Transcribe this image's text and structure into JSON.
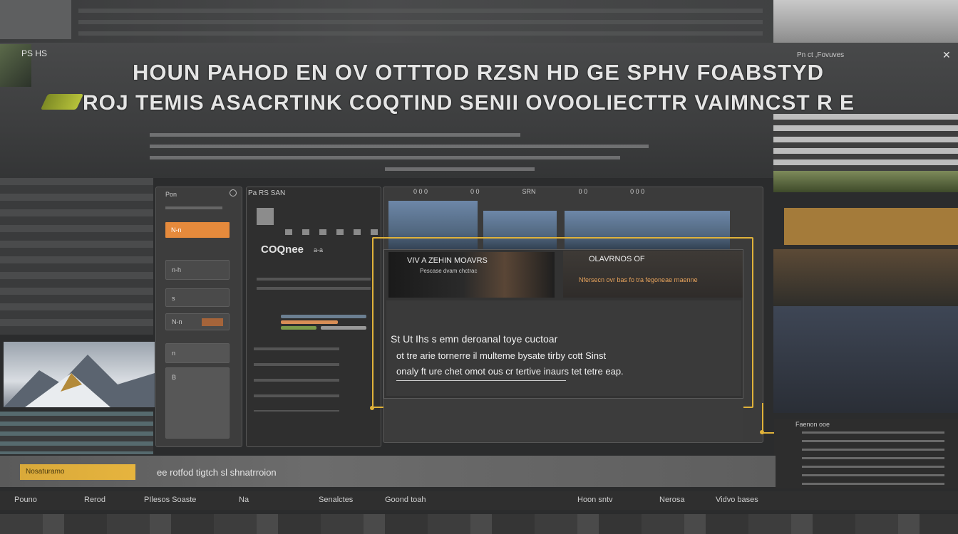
{
  "header": {
    "top_left_label": "PS HS",
    "top_right_label": "Pn ct ,Fovuves",
    "title_line1": "HOUN PAHOD EN OV OTTTOD RZSN HD GE SPHV FOABSTYD",
    "title_line2": "ROJ TEMIS ASACRTINK COQTIND SENII OVOOLIECTTR VAIMNCST R E"
  },
  "left_panel": {
    "header_label": "Pon",
    "accent_item_label": "N-n",
    "items": [
      "n-h",
      "s",
      "N-n",
      "n",
      "B"
    ]
  },
  "mid_panel": {
    "tab_label": "Pa RS SAN",
    "status_label": "COQnee",
    "status_sub": "a-a"
  },
  "preview_tabs": [
    "0 0 0",
    "0 0",
    "SRN",
    "0 0",
    "0 0 0"
  ],
  "dialog": {
    "header_left": "VIV A ZEHIN MOAVRS",
    "header_left_sub": "Pescase dvam chctrac",
    "header_right": "OLAVRNOS OF",
    "header_right_sub": "Nfersecn ovr bas fo tra fegoneae rnaenne",
    "body_line1": "St Ut Ihs s emn deroanal toye cuctoar",
    "body_line2": "ot tre arie tornerre il multeme bysate tirby cott Sinst",
    "body_line3": "onaly ft ure chet omot ous cr tertive inaurs tet tetre eap."
  },
  "bottom_bar": {
    "accent_label": "Nosaturamo",
    "label": "ee rotfod tigtch sl shnatrroion"
  },
  "bottom_tabs": [
    "Pouno",
    "Rerod",
    "PIlesos Soaste",
    "Na",
    "Senalctes",
    "Goond toah",
    "Hoon sntv",
    "Nerosa",
    "Vidvo bases"
  ],
  "right_panel": {
    "header": "Faenon ooe"
  },
  "colors": {
    "accent_orange": "#e58a3c",
    "highlight_yellow": "#e0b23a",
    "panel_dark": "#2c2c2c",
    "bg": "#2b2c2d"
  }
}
